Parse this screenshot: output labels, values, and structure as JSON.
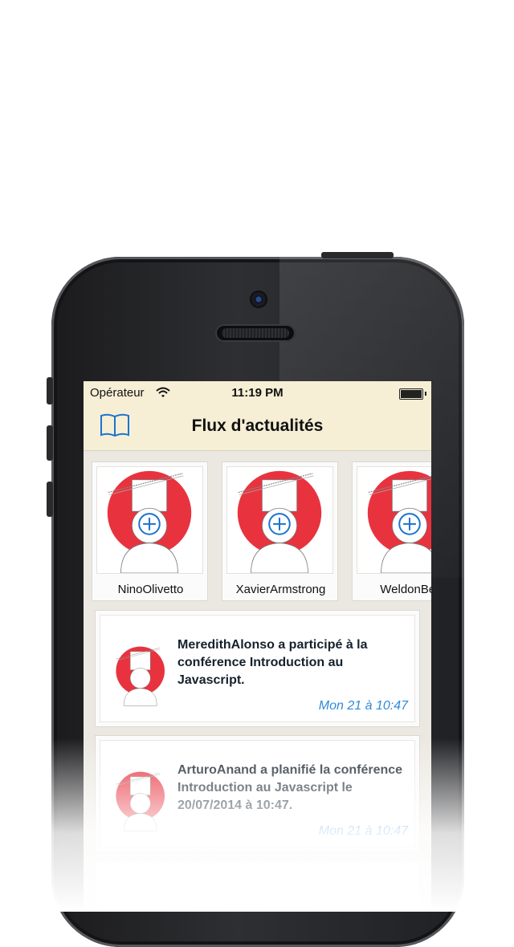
{
  "status_bar": {
    "carrier": "Opérateur",
    "time": "11:19 PM",
    "wifi_icon": "wifi-icon",
    "battery_icon": "battery-icon"
  },
  "nav": {
    "title": "Flux d'actualités",
    "left_icon": "book-icon"
  },
  "colors": {
    "accent": "#1a73d0",
    "avatar_red": "#e8333f",
    "nav_bg": "#f6efd5",
    "time_blue": "#2e8ad8"
  },
  "people": [
    {
      "name": "NinoOlivetto",
      "icon": "add-friend-icon"
    },
    {
      "name": "XavierArmstrong",
      "icon": "add-friend-icon"
    },
    {
      "name": "WeldonBec",
      "icon": "add-friend-icon"
    }
  ],
  "feed": [
    {
      "text": "MeredithAlonso a participé à la conférence Introduction au Javascript.",
      "time": "Mon 21 à 10:47"
    },
    {
      "text": "ArturoAnand a planifié la conférence Introduction au Javascript le 20/07/2014 à 10:47.",
      "time": "Mon 21 à 10:47"
    }
  ]
}
